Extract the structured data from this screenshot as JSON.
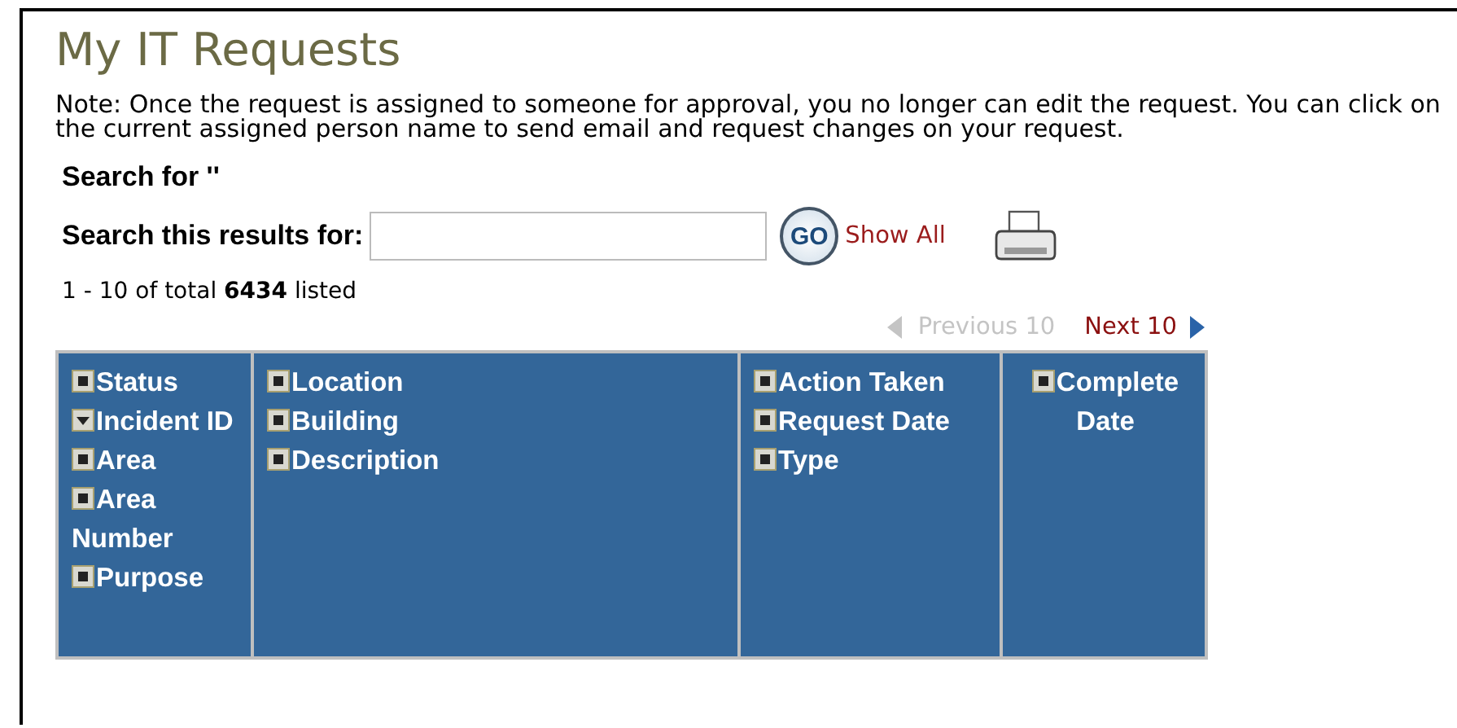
{
  "title": "My IT Requests",
  "note": "Note: Once the request is assigned to someone for approval, you no longer can edit the request. You can click on the current assigned person name to send email and request changes on your request.",
  "search_for": "Search for ''",
  "search": {
    "label": "Search this results for:",
    "go": "GO",
    "show_all": "Show All"
  },
  "count": "1 - 10 of total **6434** listed",
  "pager": {
    "previous": {
      "label": "Previous 10",
      "disabled": true
    },
    "next": {
      "label": "Next 10",
      "disabled": false
    }
  },
  "columns": [
    {
      "fields": [
        {
          "label": "Status",
          "sorted": false
        },
        {
          "label": "Incident ID",
          "sorted": true
        },
        {
          "label": "Area",
          "sorted": false
        },
        {
          "label": "Area Number",
          "sorted": false
        },
        {
          "label": "Purpose",
          "sorted": false
        }
      ]
    },
    {
      "fields": [
        {
          "label": "Location",
          "sorted": false
        },
        {
          "label": "Building",
          "sorted": false
        },
        {
          "label": "Description",
          "sorted": false
        }
      ]
    },
    {
      "fields": [
        {
          "label": "Action Taken",
          "sorted": false
        },
        {
          "label": "Request Date",
          "sorted": false
        },
        {
          "label": "Type",
          "sorted": false
        }
      ]
    },
    {
      "fields": [
        {
          "label": "Complete Date",
          "sorted": false
        }
      ]
    }
  ]
}
